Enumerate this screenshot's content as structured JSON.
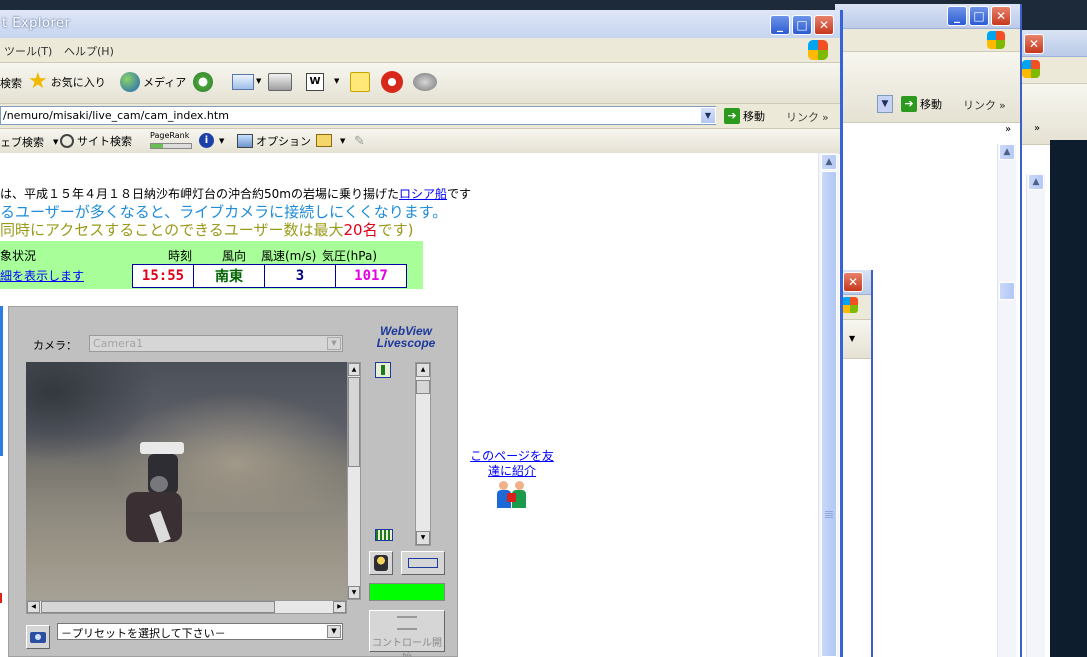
{
  "main_window": {
    "title": "t Explorer",
    "menu": [
      "ツール(T)",
      "ヘルプ(H)"
    ],
    "toolbar": {
      "search_label": "検索",
      "favorites_label": "お気に入り",
      "media_label": "メディア"
    },
    "address_url": "/nemuro/misaki/live_cam/cam_index.htm",
    "go_label": "移動",
    "links_label": "リンク",
    "google_bar": {
      "web_search_label": "ェブ検索",
      "site_search_label": "サイト検索",
      "pagerank_label": "PageRank",
      "options_label": "オプション"
    }
  },
  "background_window": {
    "go_label": "移動",
    "links_label": "リンク"
  },
  "page": {
    "intro_prefix": "は、平成１５年４月１８日納沙布岬灯台の沖合約50mの岩場に乗り揚げた",
    "intro_link": "ロシア船",
    "intro_suffix": "です",
    "warning_blue": "るユーザーが多くなると、ライブカメラに接続しにくくなります。",
    "warning_olive_prefix": "同時にアクセスすることのできるユーザー数は最大",
    "warning_red": "20名",
    "warning_olive_suffix": "です)",
    "weather": {
      "title": "象状況",
      "detail_link": "細を表示します",
      "headers": [
        "時刻",
        "風向",
        "風速(m/s)",
        "気圧(hPa)"
      ],
      "values": [
        "15:55",
        "南東",
        "3",
        "1017"
      ],
      "value_colors": [
        "#e0001a",
        "#006400",
        "#000080",
        "#e000e0"
      ]
    },
    "referral_link_line1": "このページを友",
    "referral_link_line2": "達に紹介"
  },
  "camera_viewer": {
    "camera_label": "カメラ：",
    "camera_select": "Camera1",
    "brand_line1": "WebView",
    "brand_line2": "Livescope",
    "preset_select": "－プリセットを選択して下さい－",
    "control_start": "コントロール開始"
  }
}
